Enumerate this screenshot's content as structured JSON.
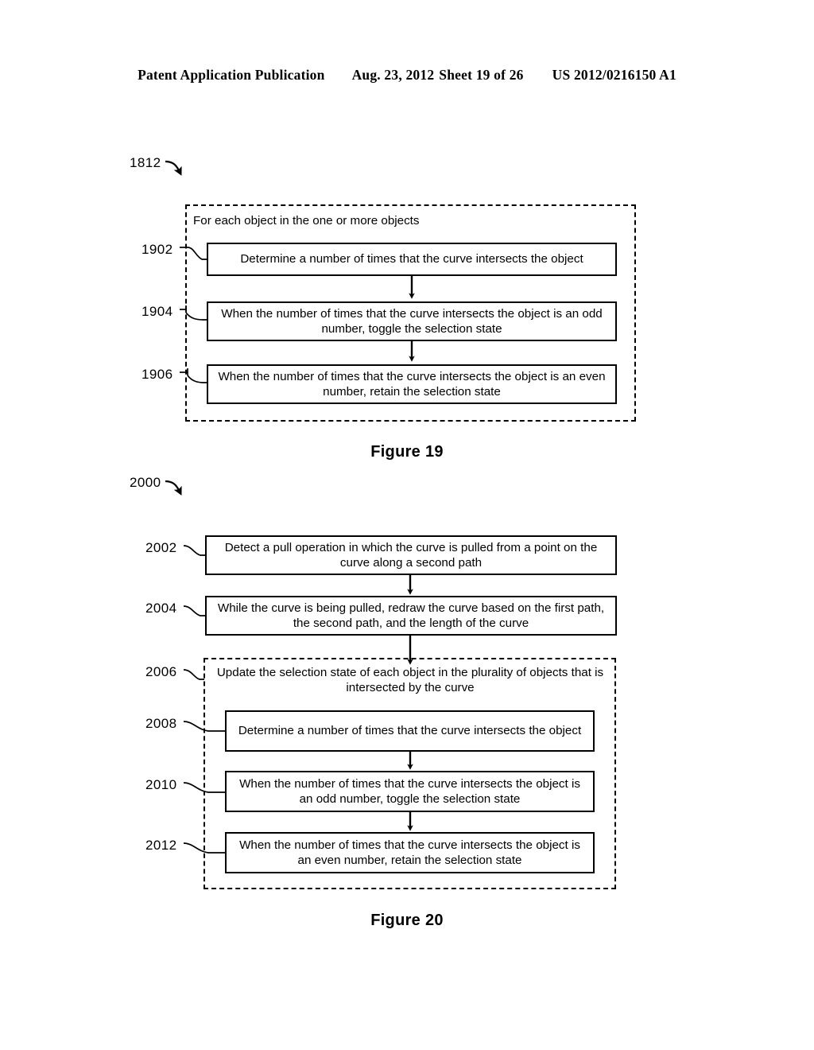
{
  "header": {
    "publication": "Patent Application Publication",
    "date": "Aug. 23, 2012",
    "sheet": "Sheet 19 of 26",
    "patent_number": "US 2012/0216150 A1"
  },
  "figure19": {
    "caption": "Figure 19",
    "flow_ref": "1812",
    "group_heading": "For each object in the one or more objects",
    "steps": [
      {
        "ref": "1902",
        "text": "Determine a number of times that the curve intersects the object"
      },
      {
        "ref": "1904",
        "text": "When the number of times that the curve intersects the object is an odd number, toggle the selection state"
      },
      {
        "ref": "1906",
        "text": "When the number of times that the curve intersects the object is an even number, retain the selection state"
      }
    ]
  },
  "figure20": {
    "caption": "Figure 20",
    "flow_ref": "2000",
    "steps": [
      {
        "ref": "2002",
        "text": "Detect a pull operation in which the curve is pulled from a point on the curve along a second path"
      },
      {
        "ref": "2004",
        "text": "While the curve is being pulled, redraw the curve based on the first path, the second path, and the length of the curve"
      }
    ],
    "group_ref": "2006",
    "group_heading": "Update the selection state of each object in the plurality of objects that is intersected by the curve",
    "group_steps": [
      {
        "ref": "2008",
        "text": "Determine a number of times that the curve intersects the object"
      },
      {
        "ref": "2010",
        "text": "When the number of times that the curve intersects the object is an odd number, toggle the selection state"
      },
      {
        "ref": "2012",
        "text": "When the number of times that the curve intersects the object is an even number, retain the selection state"
      }
    ]
  },
  "colors": {
    "ink": "#000000",
    "paper": "#ffffff"
  }
}
